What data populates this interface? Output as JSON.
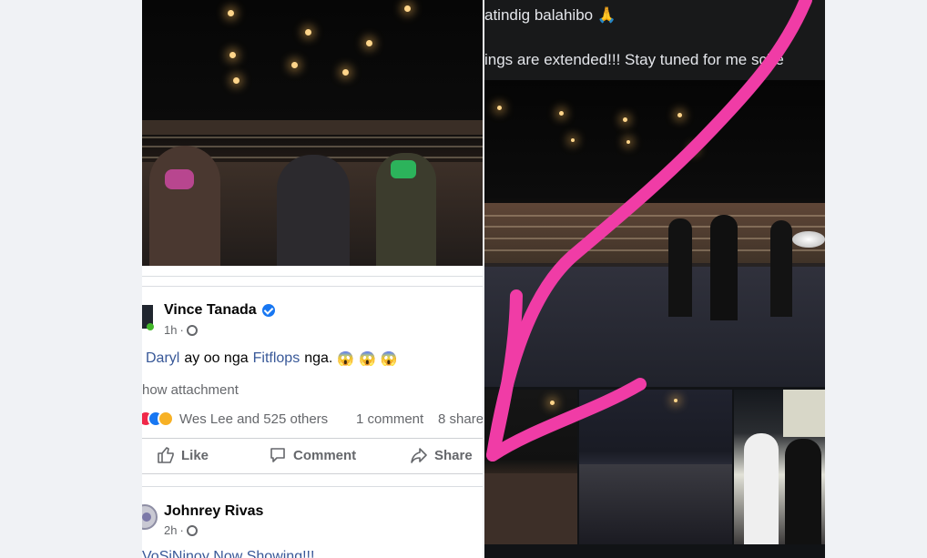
{
  "left_post": {
    "author": "Vince Tanada",
    "time": "1h",
    "mentions": [
      "Daryl",
      "Fitflops"
    ],
    "text_parts": [
      "ay oo nga",
      "nga."
    ],
    "show_attachment": "how attachment",
    "reactions_text": "Wes Lee and 525 others",
    "comments_text": "1 comment",
    "shares_text": "8 share",
    "actions": {
      "like": "Like",
      "comment": "Comment",
      "share": "Share"
    },
    "second_author": "Johnrey Rivas",
    "second_time": "2h",
    "second_preview": "VoSiNinoy Now Showing!!!"
  },
  "right_post": {
    "caption_line_1": "atindig balahibo",
    "caption_line_2": "ings are extended!!! Stay tuned for m",
    "caption_line_2_end": "e sche",
    "pray_emoji": "🙏"
  },
  "emoji": {
    "shock": "😱"
  },
  "colors": {
    "facebook_blue": "#1877f2",
    "link_blue": "#385898",
    "arrow_pink": "#f03ca6"
  },
  "icons": {
    "verified": "verified-check-icon",
    "globe": "globe-icon",
    "like": "thumbs-up-icon",
    "comment": "comment-bubble-icon",
    "share": "share-arrow-icon"
  }
}
